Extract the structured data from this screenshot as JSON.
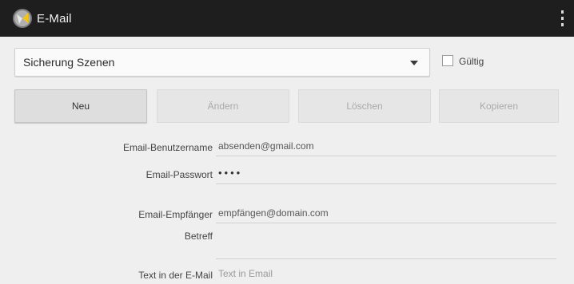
{
  "app_bar": {
    "title": "E-Mail"
  },
  "scene_selector": {
    "selected": "Sicherung Szenen"
  },
  "valid_checkbox": {
    "label": "Gültig",
    "checked": false
  },
  "actions": {
    "new_label": "Neu",
    "edit_label": "Ändern",
    "delete_label": "Löschen",
    "copy_label": "Kopieren"
  },
  "form": {
    "username": {
      "label": "Email-Benutzername",
      "value": "absenden@gmail.com"
    },
    "password": {
      "label": "Email-Passwort",
      "value": "••••"
    },
    "recipient": {
      "label": "Email-Empfänger",
      "value": "empfängen@domain.com"
    },
    "subject": {
      "label": "Betreff",
      "value": ""
    },
    "body_text": {
      "label": "Text in der E-Mail",
      "placeholder": "Text in Email"
    }
  }
}
